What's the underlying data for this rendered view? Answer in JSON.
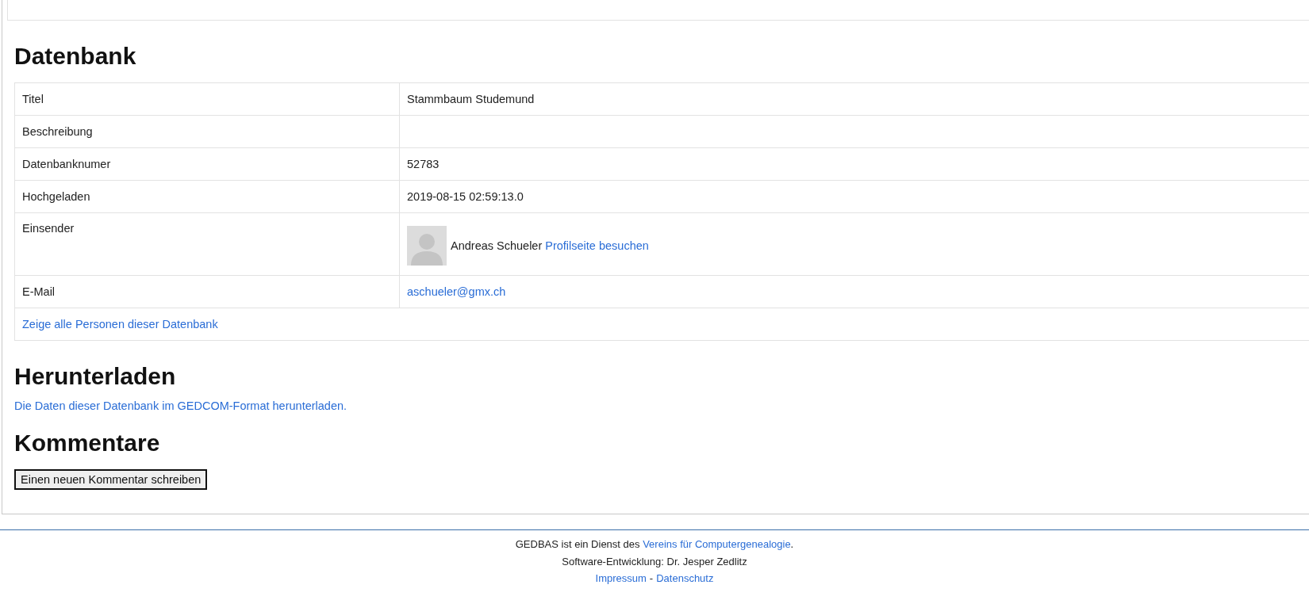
{
  "database": {
    "heading": "Datenbank",
    "rows": [
      {
        "kind": "text",
        "label": "Titel",
        "value": "Stammbaum Studemund"
      },
      {
        "kind": "text",
        "label": "Beschreibung"
      },
      {
        "kind": "text",
        "label": "Datenbanknumer",
        "value": "52783"
      },
      {
        "kind": "text",
        "label": "Hochgeladen",
        "value": "2019-08-15 02:59:13.0"
      },
      {
        "kind": "submitter",
        "label": "Einsender",
        "name": "Andreas Schueler",
        "link": "Profilseite besuchen"
      },
      {
        "kind": "link",
        "label": "E-Mail",
        "value": "aschueler@gmx.ch"
      },
      {
        "kind": "wide-link",
        "value": "Zeige alle Personen dieser Datenbank"
      }
    ]
  },
  "download": {
    "heading": "Herunterladen",
    "link": "Die Daten dieser Datenbank im GEDCOM-Format herunterladen."
  },
  "comments": {
    "heading": "Kommentare",
    "button": "Einen neuen Kommentar schreiben"
  },
  "footer": {
    "service_text": "GEDBAS ist ein Dienst des",
    "service_link": "Vereins für Computergenealogie",
    "service_end": ".",
    "credit": "Software-Entwicklung: Dr. Jesper Zedlitz",
    "links": [
      "Impressum",
      "Datenschutz"
    ],
    "separator": "-"
  }
}
